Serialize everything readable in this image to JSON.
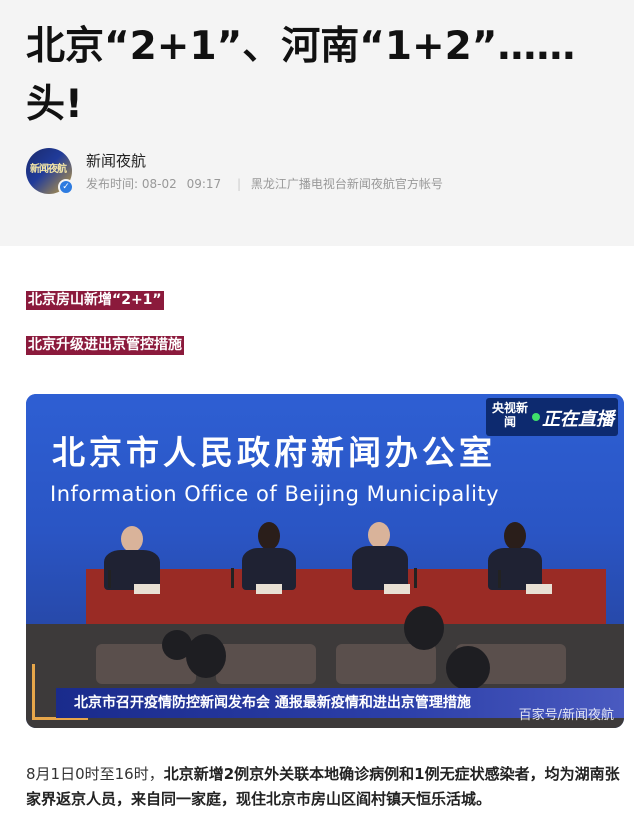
{
  "article": {
    "title_line1": "北京“2+1”、河南“1+2”……",
    "title_line2": "头!"
  },
  "author": {
    "name": "新闻夜航",
    "avatar_text": "新闻夜航",
    "publish_label": "发布时间: 08-02",
    "publish_time": "09:17",
    "account": "黑龙江广播电视台新闻夜航官方帐号"
  },
  "highlights": {
    "line1": "北京房山新增“2+1”",
    "line2": "北京升级进出京管控措施"
  },
  "figure": {
    "wall_cn": "北京市人民政府新闻办公室",
    "wall_en": "Information Office of Beijing Municipality",
    "logo_cctv": "央视新闻",
    "logo_live": "正在直播",
    "caption": "北京市召开疫情防控新闻发布会 通报最新疫情和进出京管理措施",
    "watermark": "百家号/新闻夜航"
  },
  "body": {
    "plain": "8月1日0时至16时，",
    "bold": "北京新增2例京外关联本地确诊病例和1例无症状感染者，均为湖南张家界返京人员，来自同一家庭，现住北京市房山区阎村镇天恒乐活城。"
  },
  "colors": {
    "highlight_bg": "#8b1a3c",
    "wall_blue": "#2e5fd3",
    "caption_blue": "#1a2b8c"
  }
}
